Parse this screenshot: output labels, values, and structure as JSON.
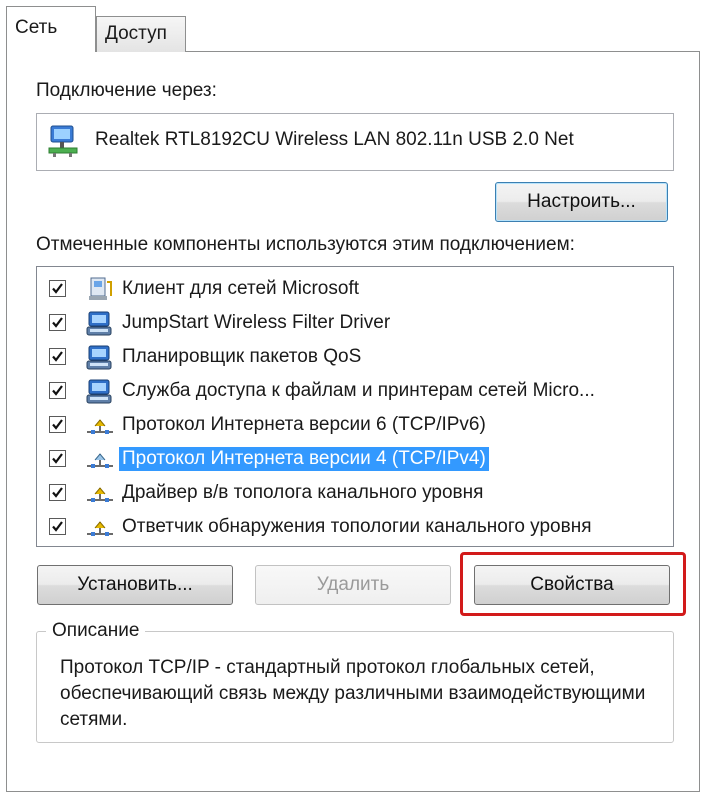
{
  "tabs": [
    {
      "label": "Сеть",
      "active": true
    },
    {
      "label": "Доступ",
      "active": false
    }
  ],
  "connect_via_label": "Подключение через:",
  "adapter": {
    "name": "Realtek RTL8192CU Wireless LAN 802.11n USB 2.0 Net",
    "icon": "network-adapter-icon"
  },
  "configure_button": "Настроить...",
  "components_label": "Отмеченные компоненты используются этим подключением:",
  "components": [
    {
      "label": "Клиент для сетей Microsoft",
      "checked": true,
      "icon": "network-client-icon"
    },
    {
      "label": "JumpStart Wireless Filter Driver",
      "checked": true,
      "icon": "network-service-icon"
    },
    {
      "label": "Планировщик пакетов QoS",
      "checked": true,
      "icon": "network-service-icon"
    },
    {
      "label": "Служба доступа к файлам и принтерам сетей Micro...",
      "checked": true,
      "icon": "network-service-icon"
    },
    {
      "label": "Протокол Интернета версии 6 (TCP/IPv6)",
      "checked": true,
      "icon": "protocol-icon"
    },
    {
      "label": "Протокол Интернета версии 4 (TCP/IPv4)",
      "checked": true,
      "icon": "protocol-icon",
      "selected": true
    },
    {
      "label": "Драйвер в/в тополога канального уровня",
      "checked": true,
      "icon": "protocol-icon"
    },
    {
      "label": "Ответчик обнаружения топологии канального уровня",
      "checked": true,
      "icon": "protocol-icon"
    }
  ],
  "buttons": {
    "install": "Установить...",
    "remove": "Удалить",
    "properties": "Свойства"
  },
  "description": {
    "title": "Описание",
    "text": "Протокол TCP/IP - стандартный протокол глобальных сетей, обеспечивающий связь между различными взаимодействующими сетями."
  },
  "colors": {
    "selection": "#3399ff",
    "highlight": "#d21a1a"
  }
}
